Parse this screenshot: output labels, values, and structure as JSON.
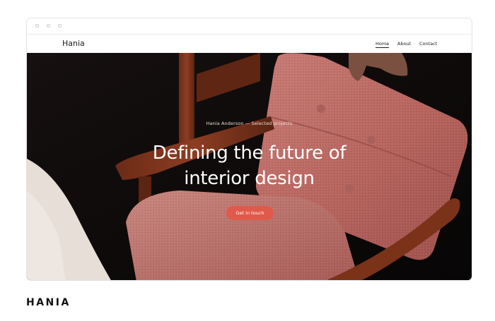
{
  "nav": {
    "brand": "Hania",
    "links": [
      {
        "label": "Home",
        "active": true
      },
      {
        "label": "About",
        "active": false
      },
      {
        "label": "Contact",
        "active": false
      }
    ]
  },
  "hero": {
    "eyebrow": "Hania Anderson — Selected projects",
    "headline_line1": "Defining the future of",
    "headline_line2": "interior design",
    "cta_label": "Get in touch"
  },
  "footer": {
    "brand_wordmark": "HANIA"
  },
  "colors": {
    "accent": "#e0594a",
    "hero_background": "#0d0b0b",
    "text_dark": "#1a1a1a"
  }
}
